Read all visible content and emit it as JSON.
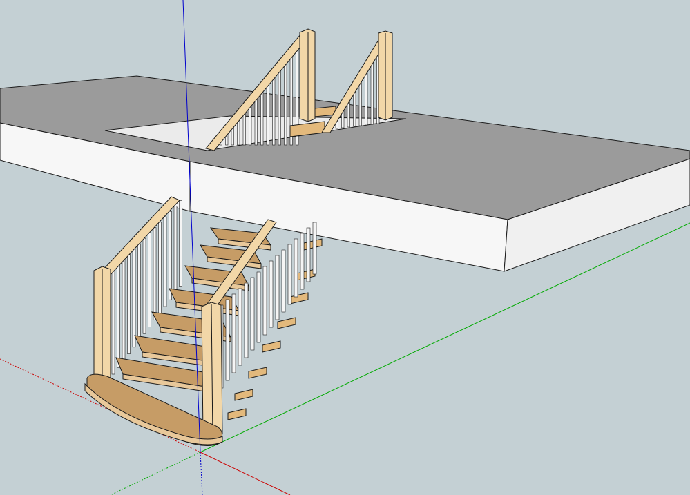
{
  "app": {
    "view": "3d-model-viewport",
    "background_color": "#c4d0d4"
  },
  "colors": {
    "floor_top": "#9b9b9b",
    "floor_side": "#f7f7f7",
    "floor_opening": "#ebebeb",
    "tread": "#c69c66",
    "tread_side": "#e8c89a",
    "wood_light": "#f2d7a8",
    "wood_mid": "#e3b97c",
    "wood_dark": "#caa06a",
    "baluster": "#f5f5f5",
    "baluster_shade": "#bdbdbd",
    "outline": "#1a1a1a",
    "axis_red": "#cc0000",
    "axis_green": "#00aa00",
    "axis_blue": "#0000cc"
  },
  "model": {
    "objects": [
      "upper-floor-slab",
      "floor-opening",
      "winder-staircase",
      "handrail-left",
      "handrail-right",
      "upper-balustrade"
    ],
    "tread_count": 12
  },
  "axes": {
    "red": "red-axis",
    "green": "green-axis",
    "blue": "blue-axis"
  }
}
